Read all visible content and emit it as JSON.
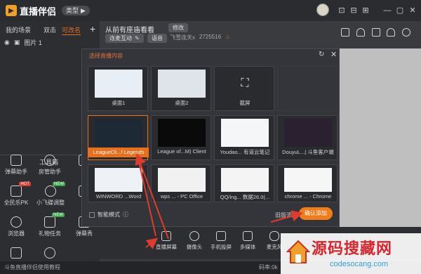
{
  "app": {
    "title": "直播伴侣",
    "type_badge": "类型",
    "type_chevron": "▶"
  },
  "window": {
    "controls": [
      "⊡",
      "⊟",
      "⊞",
      "—",
      "▢",
      "✕"
    ]
  },
  "sidebar": {
    "tabs": [
      {
        "label": "我的场景"
      },
      {
        "label": "双击"
      },
      {
        "label": "可改名",
        "active": true
      }
    ],
    "add": "+",
    "source_item": "图片 1",
    "tools_title": "工具箱",
    "tools": [
      {
        "label": "弹幕助手",
        "icon": "danmaku-icon"
      },
      {
        "label": "房管助手",
        "icon": "admin-icon"
      },
      {
        "label": "视",
        "icon": "video-icon"
      },
      {
        "label": "全民乐PK",
        "icon": "pk-icon",
        "hot": "HOT"
      },
      {
        "label": "小飞碟调整",
        "icon": "ufo-icon",
        "hot": "NEW"
      },
      {
        "label": "数",
        "icon": "data-icon"
      },
      {
        "label": "浏览器",
        "icon": "browser-icon"
      },
      {
        "label": "礼物任务",
        "icon": "gift-task-icon",
        "hot": "NEW"
      },
      {
        "label": "弹幕秀",
        "icon": "danmaku-show-icon"
      },
      {
        "label": "",
        "icon": "gift-icon"
      },
      {
        "label": "",
        "icon": "search-icon"
      }
    ]
  },
  "room": {
    "title": "从前有座庙看看",
    "edit": "修改",
    "category": "连麦互动",
    "voice": "语音",
    "user": "飞雪连天x",
    "id": "2725516",
    "heat_icon": "fire-icon"
  },
  "dialog": {
    "title": "选择直播内容",
    "refresh": "↻",
    "close": "✕",
    "cards": [
      {
        "label": "桌面1",
        "thumb": "desktop"
      },
      {
        "label": "桌面2",
        "thumb": "desktop"
      },
      {
        "label": "截屏",
        "thumb": "crop"
      },
      {
        "label": "",
        "thumb": "blank"
      },
      {
        "label": "LeagueCli...f Legends",
        "thumb": "game",
        "selected": true
      },
      {
        "label": "League of...M) Client",
        "thumb": "black"
      },
      {
        "label": "Youdao... 有道云笔记",
        "thumb": "doc"
      },
      {
        "label": "DouyuL...| 斗鱼客户端",
        "thumb": "game"
      },
      {
        "label": "WINWORD ...Word",
        "thumb": "doc"
      },
      {
        "label": "wps ... - PC Office",
        "thumb": "doc"
      },
      {
        "label": "QQ/ing... 数据26.0(...",
        "thumb": "doc"
      },
      {
        "label": "chrome ... - Chrome",
        "thumb": "doc"
      }
    ],
    "smart_mode": "智能模式",
    "old_add": "旧版添加",
    "confirm": "确认添加"
  },
  "source_bar": [
    {
      "label": "直播屏幕",
      "icon": "screen-icon"
    },
    {
      "label": "摄像头",
      "icon": "camera-icon"
    },
    {
      "label": "手机投屏",
      "icon": "phone-cast-icon"
    },
    {
      "label": "多媒体",
      "icon": "media-icon"
    },
    {
      "label": "麦克风",
      "icon": "mic-icon"
    }
  ],
  "status": {
    "text": "斗鱼直播伴侣使用教程",
    "right": "码率:0k"
  },
  "watermark": {
    "title": "源码搜藏网",
    "url": "codesocang.com"
  },
  "colors": {
    "accent": "#f07d1a",
    "arrow": "#e03a2e",
    "bg": "#3a3b3f"
  }
}
